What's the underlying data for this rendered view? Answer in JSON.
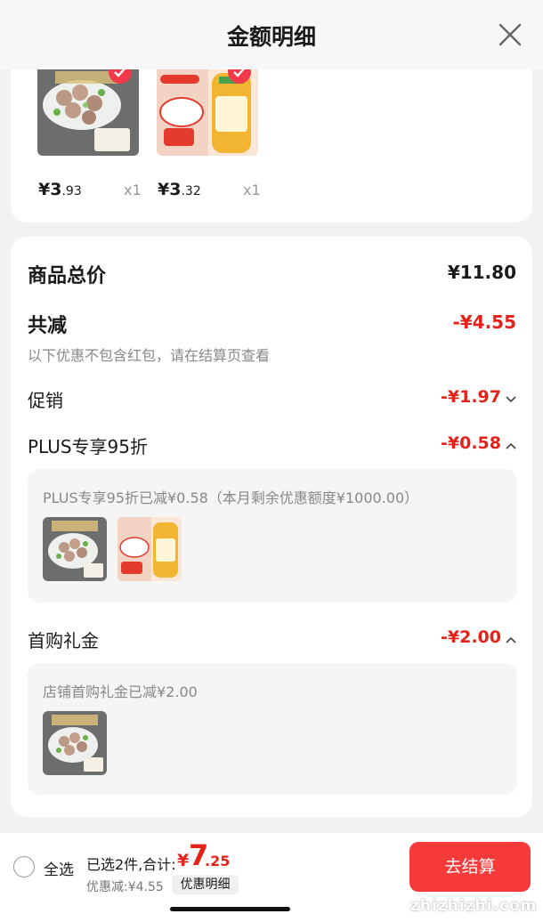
{
  "header": {
    "title": "金额明细"
  },
  "items": [
    {
      "name": "meatballs",
      "price_symbol": "¥",
      "price_int": "3",
      "price_dec": ".93",
      "qty": "x1"
    },
    {
      "name": "broth",
      "price_symbol": "¥",
      "price_int": "3",
      "price_dec": ".32",
      "qty": "x1"
    }
  ],
  "summary": {
    "total_label": "商品总价",
    "total_value": "¥11.80",
    "reduce_label": "共减",
    "reduce_value": "-¥4.55",
    "reduce_note": "以下优惠不包含红包，请在结算页查看",
    "promo_label": "促销",
    "promo_value": "-¥1.97",
    "plus_label": "PLUS专享95折",
    "plus_value": "-¥0.58",
    "plus_detail": "PLUS专享95折已减¥0.58（本月剩余优惠额度¥1000.00）",
    "gift_label": "首购礼金",
    "gift_value": "-¥2.00",
    "gift_detail": "店铺首购礼金已减¥2.00"
  },
  "bottom": {
    "select_all": "全选",
    "selected_total": "已选2件,合计:",
    "total_symbol": "¥",
    "total_int": "7",
    "total_dec": ".25",
    "discount": "优惠减:¥4.55",
    "detail_button": "优惠明细",
    "checkout": "去结算"
  },
  "watermark": "zhizhizhi.com",
  "colors": {
    "accent": "#e2231a",
    "checkout": "#f63a3a"
  }
}
